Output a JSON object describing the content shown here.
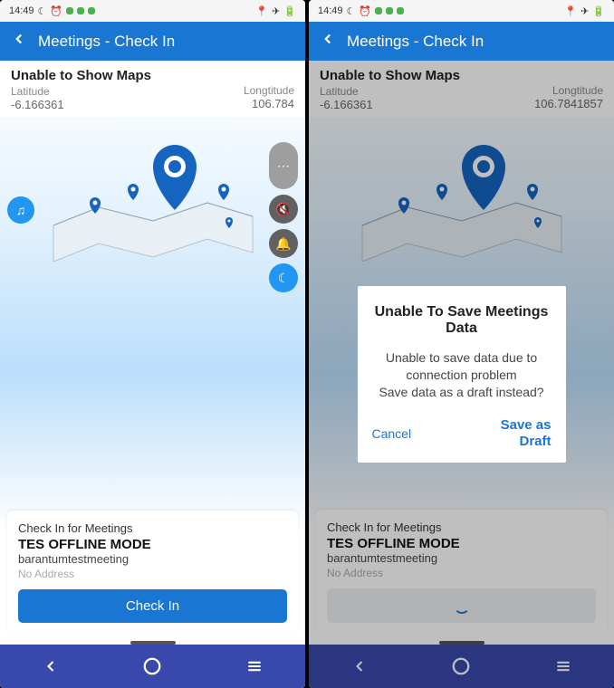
{
  "statusBar": {
    "time": "14:49"
  },
  "header": {
    "title": "Meetings - Check In"
  },
  "coords": {
    "error": "Unable to Show Maps",
    "latLabel": "Latitude",
    "lat": "-6.166361",
    "lngLabel": "Longtitude",
    "lng": "106.7841857",
    "lngTrunc": "106.784"
  },
  "checkCard": {
    "title": "Check In for Meetings",
    "name": "TES OFFLINE MODE",
    "sub": "barantumtestmeeting",
    "noAddr": "No Address",
    "btn": "Check In"
  },
  "dialog": {
    "title": "Unable To Save Meetings Data",
    "msg": "Unable to save data due to connection problem\nSave data as a draft instead?",
    "cancel": "Cancel",
    "save": "Save as\nDraft"
  }
}
